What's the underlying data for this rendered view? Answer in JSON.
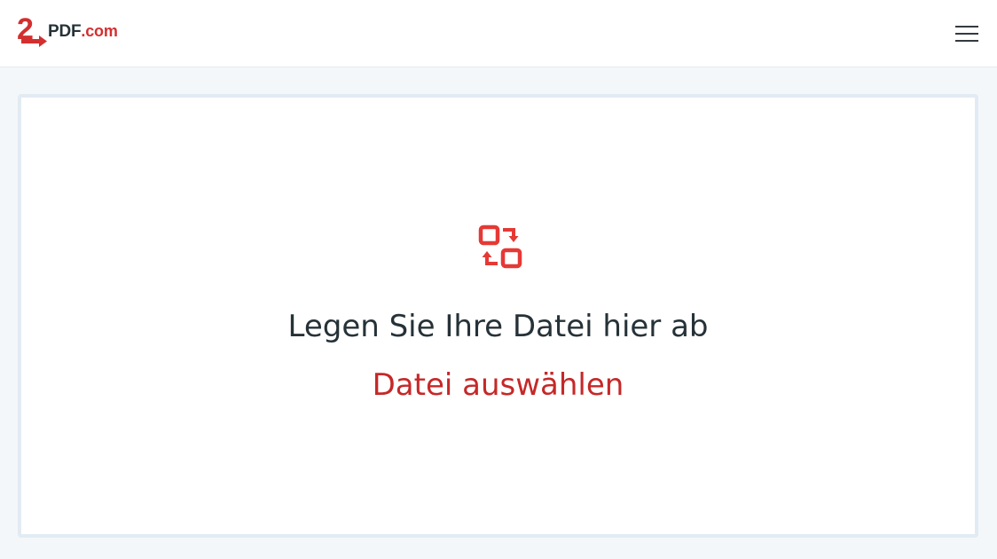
{
  "header": {
    "logo": {
      "mark_text": "2",
      "brand_text": "PDF",
      "tld_text": ".com"
    },
    "menu_icon": "hamburger-menu-icon"
  },
  "dropzone": {
    "icon": "convert-arrows-icon",
    "drop_text": "Legen Sie Ihre Datei hier ab",
    "choose_file_label": "Datei auswählen"
  },
  "colors": {
    "accent": "#d32f2f",
    "link": "#c62828",
    "text": "#263238",
    "background": "#f4f7f9"
  }
}
